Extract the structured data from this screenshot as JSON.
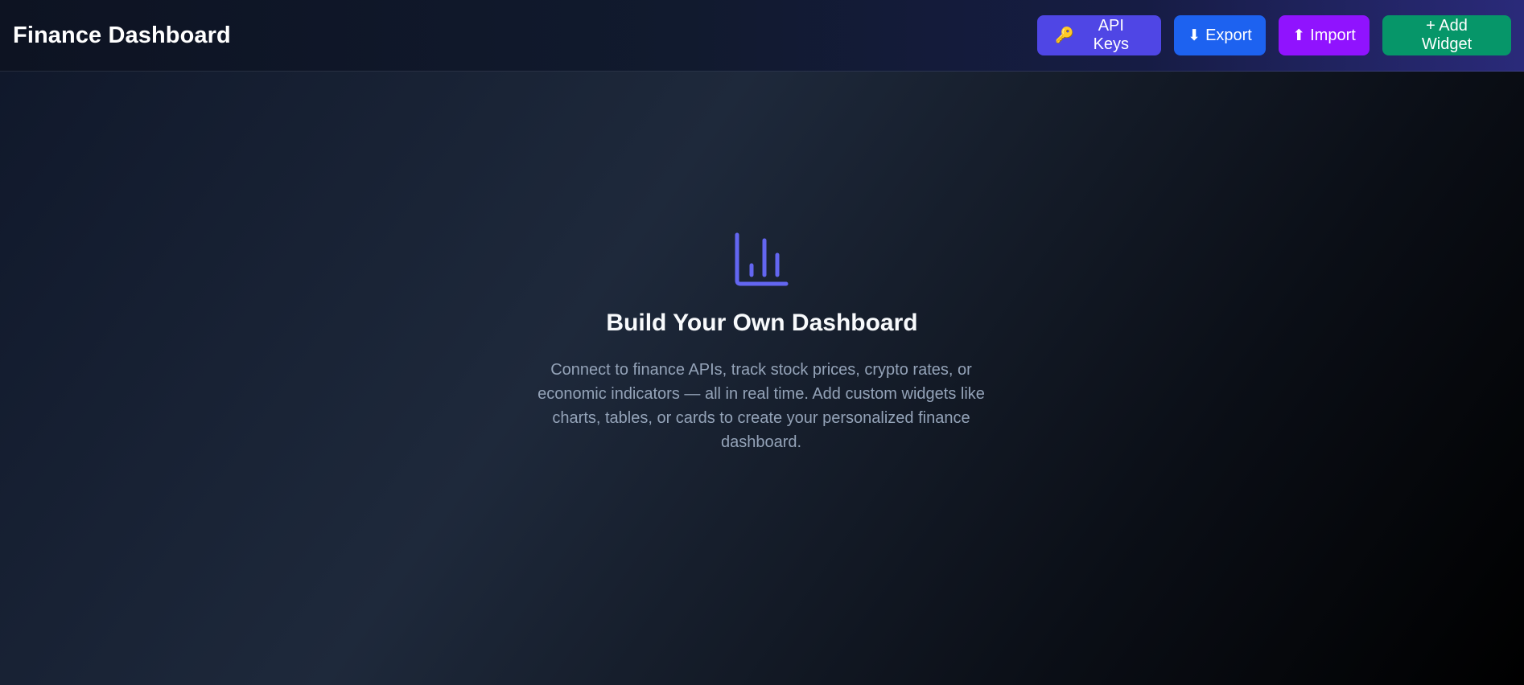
{
  "header": {
    "title": "Finance Dashboard",
    "buttons": {
      "api_keys": {
        "icon": "key-icon",
        "glyph": "🔑",
        "label": "API Keys"
      },
      "export": {
        "icon": "download-arrow-icon",
        "glyph": "⬇",
        "label": "Export"
      },
      "import": {
        "icon": "upload-arrow-icon",
        "glyph": "⬆",
        "label": "Import"
      },
      "add_widget": {
        "label": "+ Add Widget"
      }
    }
  },
  "empty_state": {
    "icon": "bar-chart-icon",
    "title": "Build Your Own Dashboard",
    "description": "Connect to finance APIs, track stock prices, crypto rates, or economic indicators — all in real time. Add custom widgets like charts, tables, or cards to create your personalized finance dashboard."
  },
  "colors": {
    "accent_indigo": "#4f46e5",
    "export_blue": "#1d62f0",
    "import_purple": "#9013fe",
    "add_green": "#069669",
    "icon_violet": "#6366f1",
    "muted_text": "#94a3b8"
  }
}
